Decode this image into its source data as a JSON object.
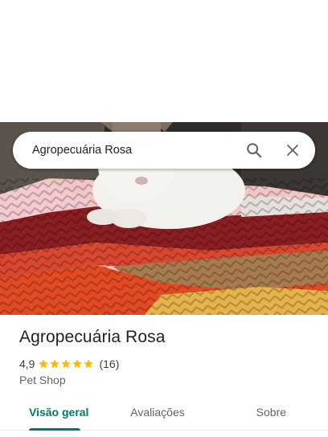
{
  "search": {
    "value": "Agropecuária Rosa",
    "search_icon": "search-icon",
    "close_icon": "close-icon"
  },
  "place": {
    "name": "Agropecuária Rosa",
    "rating": "4,9",
    "stars": 5,
    "review_count": "(16)",
    "category": "Pet Shop"
  },
  "tabs": [
    {
      "label": "Visão geral",
      "active": true
    },
    {
      "label": "Avaliações",
      "active": false
    },
    {
      "label": "Sobre",
      "active": false
    }
  ],
  "colors": {
    "accent": "#00796b",
    "star": "#fbbc04"
  }
}
